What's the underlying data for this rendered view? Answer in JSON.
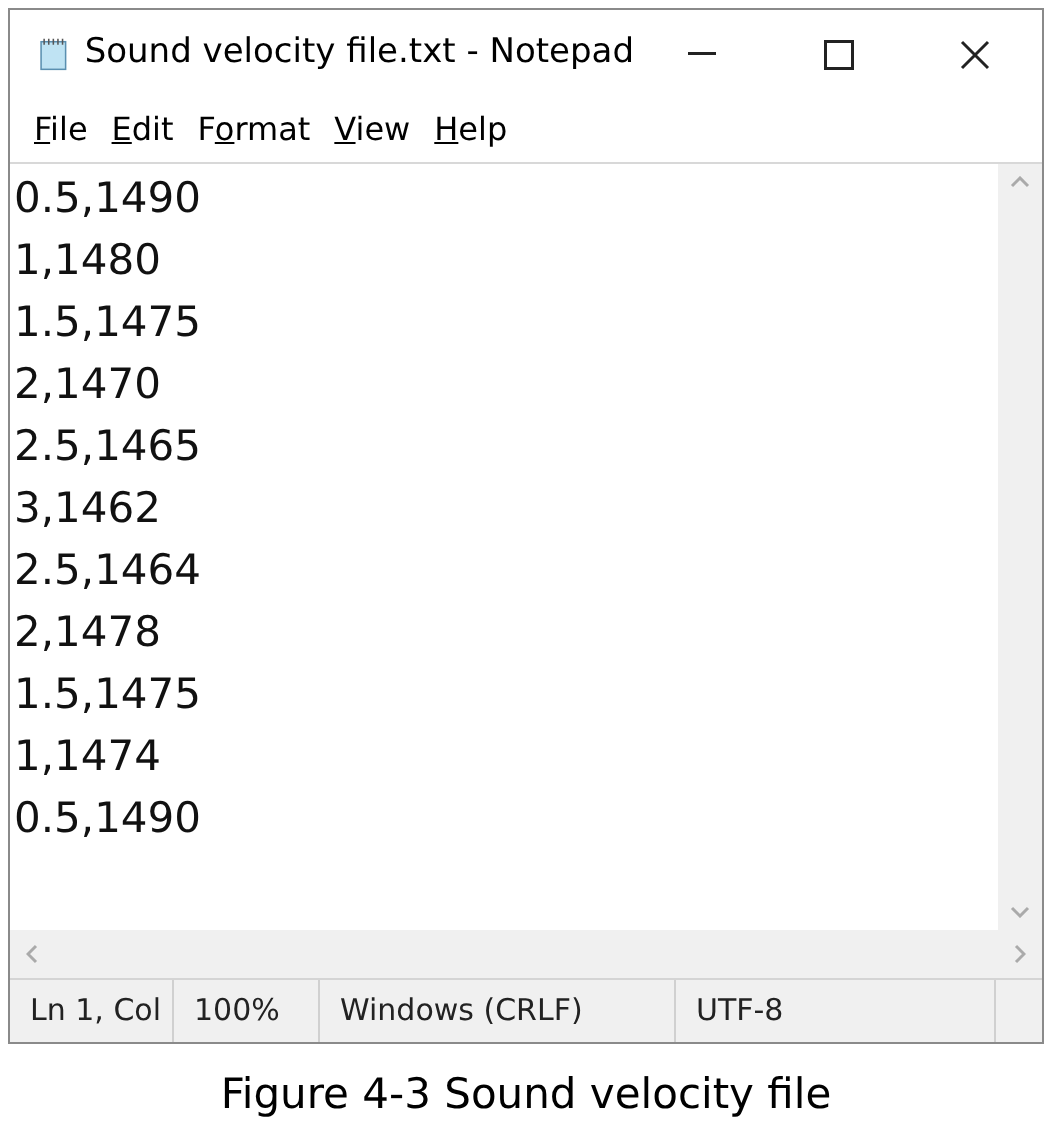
{
  "window": {
    "title": "Sound velocity file.txt - Notepad"
  },
  "menu": [
    {
      "key": "F",
      "after": "ile"
    },
    {
      "key": "E",
      "after": "dit"
    },
    {
      "before": "F",
      "key": "o",
      "after": "rmat"
    },
    {
      "key": "V",
      "after": "iew"
    },
    {
      "key": "H",
      "after": "elp"
    }
  ],
  "editor": {
    "lines": [
      "0.5,1490",
      "1,1480",
      "1.5,1475",
      "2,1470",
      "2.5,1465",
      "3,1462",
      "2.5,1464",
      "2,1478",
      "1.5,1475",
      "1,1474",
      "0.5,1490"
    ]
  },
  "status_bar": [
    "Ln 1, Col",
    "100%",
    "Windows (CRLF)",
    "UTF-8"
  ],
  "caption": "Figure 4-3 Sound velocity file"
}
